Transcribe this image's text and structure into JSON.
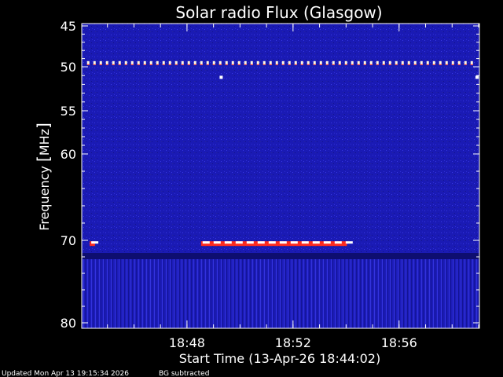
{
  "chart_data": {
    "type": "heatmap",
    "title": "Solar radio Flux (Glasgow)",
    "xlabel": "Start Time (13-Apr-26 18:44:02)",
    "ylabel_text": "Frequency ",
    "ylabel_unit": "MHz",
    "x_ticks": [
      "18:48",
      "18:52",
      "18:56"
    ],
    "x_tick_minutes": [
      3.97,
      7.97,
      11.97
    ],
    "x_range_minutes": [
      0,
      15
    ],
    "y_ticks": [
      45,
      50,
      55,
      60,
      70,
      80
    ],
    "ylim": [
      45,
      80
    ],
    "colors": {
      "background": "#1a1ab4",
      "burst": "#ff2a1e",
      "frame": "#ffffff"
    },
    "features": [
      {
        "name": "narrowband interference",
        "freq_mhz": 49.6,
        "x_start_min": 0.2,
        "x_end_min": 14.9,
        "style": "dotted"
      },
      {
        "name": "narrowband interference",
        "freq_mhz": 70.4,
        "x_start_min": 4.5,
        "x_end_min": 10.0,
        "style": "band"
      },
      {
        "name": "spike",
        "freq_mhz": 70.4,
        "x_start_min": 0.3,
        "x_end_min": 0.5,
        "style": "band"
      },
      {
        "name": "spike",
        "freq_mhz": 51.2,
        "x_start_min": 5.2,
        "x_end_min": 5.3,
        "style": "dot"
      },
      {
        "name": "spike",
        "freq_mhz": 51.2,
        "x_start_min": 14.85,
        "x_end_min": 14.95,
        "style": "dot"
      }
    ]
  },
  "footer": {
    "updated": "Updated Mon Apr 13 19:15:34 2026",
    "note": "BG subtracted"
  }
}
